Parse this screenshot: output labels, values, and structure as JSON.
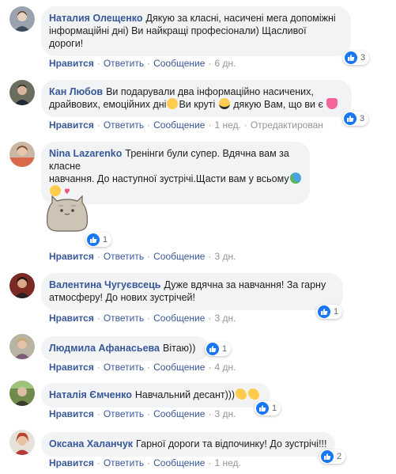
{
  "labels": {
    "like": "Нравится",
    "reply": "Ответить",
    "message": "Сообщение",
    "edited": "Отредактирован"
  },
  "comments": [
    {
      "author": "Наталия Олещенко",
      "text_lines": [
        "Дякую за класні, насичені мега допоміжні",
        "інформаційні дні) Ви найкращі професіонали) Щасливої",
        "дороги!"
      ],
      "time": "6 дн.",
      "reactions": "3"
    },
    {
      "author": "Кан Любов",
      "text_lines": [
        "Ви подарували два інформаційно насичених,",
        "драйвових, емоційних дні",
        "Ви круті",
        "дякую Вам, що ви є"
      ],
      "time": "1 нед.",
      "reactions": "3"
    },
    {
      "author": "Nina Lazarenko",
      "text_lines": [
        "Тренінги були супер. Вдячна вам за класне",
        "навчання. До наступної зустрічі.Щасти вам у всьому"
      ],
      "time": "3 дн.",
      "reactions": "1"
    },
    {
      "author": "Валентина Чугуєвсець",
      "text_lines": [
        "Дуже вдячна за навчання! За гарну",
        "атмосферу! До нових зустрічей!"
      ],
      "time": "3 дн.",
      "reactions": "1"
    },
    {
      "author": "Людмила Афанасьева",
      "text_lines": [
        "Вітаю))"
      ],
      "time": "4 дн.",
      "reactions": "1"
    },
    {
      "author": "Наталія Ємченко",
      "text_lines": [
        "Навчальний десант)))"
      ],
      "time": "3 дн.",
      "reactions": "1"
    },
    {
      "author": "Оксана Халанчук",
      "text_lines": [
        "Гарної дороги та відпочинку! До зустрічі!!!"
      ],
      "time": "1 нед.",
      "reactions": "2"
    }
  ],
  "colors": {
    "link": "#385898",
    "bubble": "#f2f3f5",
    "like_blue": "#1877f2",
    "meta": "#90949c"
  }
}
